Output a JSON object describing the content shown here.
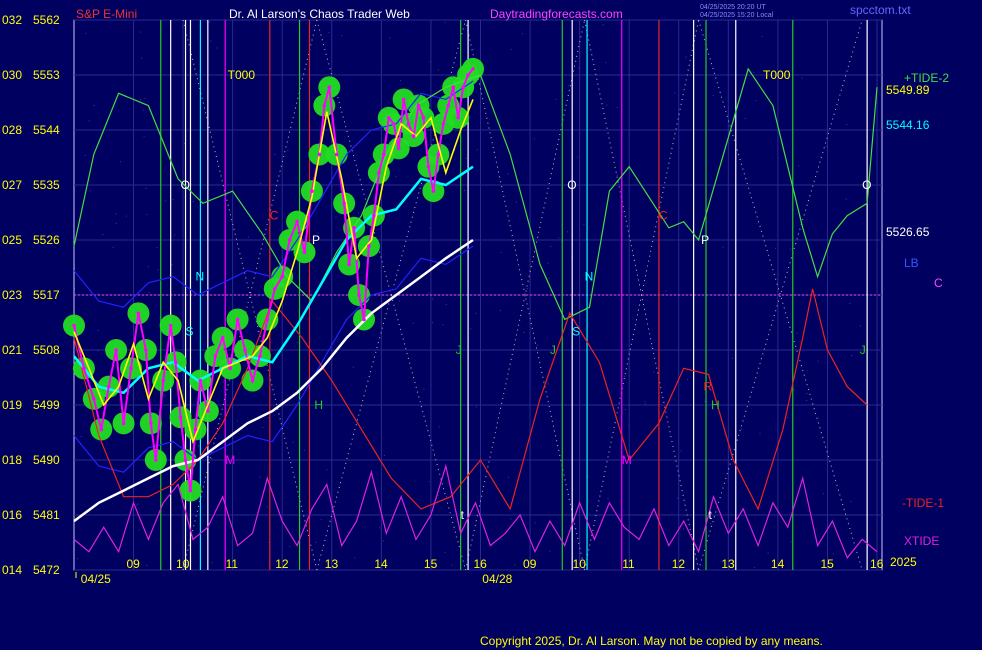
{
  "header": {
    "instrument": "S&P E-Mini",
    "author": "Dr. Al Larson's Chaos Trader Web",
    "site": "Daytradingforecasts.com",
    "stamp_utc": "04/25/2025 20:20 UT",
    "stamp_local": "04/25/2025 15:20 Local",
    "file": "spcctom.txt"
  },
  "footer": {
    "copyright": "Copyright 2025, Dr. Al Larson. May not be copied by any means."
  },
  "colors": {
    "background": "#000060",
    "frame": "#c8c8ff",
    "price": "#ff00ff",
    "fast_avg": "#ffff00",
    "slow_avg": "#00ffff",
    "long_avg": "#ffffff",
    "tide2": "#44dd44",
    "tide1": "#ee2222",
    "xtide": "#dd22dd",
    "bubble": "#22dd22"
  },
  "chart_data": {
    "type": "line",
    "title": "S&P E-Mini",
    "y_labels": [
      {
        "pre": "032",
        "price": 5562
      },
      {
        "pre": "030",
        "price": 5553
      },
      {
        "pre": "028",
        "price": 5544
      },
      {
        "pre": "027",
        "price": 5535
      },
      {
        "pre": "025",
        "price": 5526
      },
      {
        "pre": "023",
        "price": 5517
      },
      {
        "pre": "021",
        "price": 5508
      },
      {
        "pre": "019",
        "price": 5499
      },
      {
        "pre": "018",
        "price": 5490
      },
      {
        "pre": "016",
        "price": 5481
      },
      {
        "pre": "014",
        "price": 5472
      }
    ],
    "ylim": [
      5472,
      5562
    ],
    "x_hour_ticks": [
      {
        "hour": "09",
        "x": 1.2
      },
      {
        "hour": "10",
        "x": 2.2
      },
      {
        "hour": "11",
        "x": 3.2
      },
      {
        "hour": "12",
        "x": 4.2
      },
      {
        "hour": "13",
        "x": 5.2
      },
      {
        "hour": "14",
        "x": 6.2
      },
      {
        "hour": "15",
        "x": 7.2
      },
      {
        "hour": "16",
        "x": 8.2
      },
      {
        "hour": "09",
        "x": 9.2
      },
      {
        "hour": "10",
        "x": 10.2
      },
      {
        "hour": "11",
        "x": 11.2
      },
      {
        "hour": "12",
        "x": 12.2
      },
      {
        "hour": "13",
        "x": 13.2
      },
      {
        "hour": "14",
        "x": 14.2
      },
      {
        "hour": "15",
        "x": 15.2
      },
      {
        "hour": "16",
        "x": 16.2
      }
    ],
    "xlim": [
      0,
      16.3
    ],
    "dates": [
      {
        "label": "04/25",
        "x": 0.5
      },
      {
        "label": "04/28",
        "x": 8.6
      }
    ],
    "year": "2025",
    "price_series": {
      "name": "S&P E-Mini",
      "x": [
        0,
        0.2,
        0.4,
        0.55,
        0.7,
        0.85,
        1.0,
        1.15,
        1.3,
        1.45,
        1.55,
        1.65,
        1.8,
        1.95,
        2.05,
        2.15,
        2.25,
        2.35,
        2.45,
        2.55,
        2.7,
        2.85,
        3.0,
        3.15,
        3.3,
        3.45,
        3.6,
        3.75,
        3.9,
        4.05,
        4.2,
        4.35,
        4.5,
        4.65,
        4.8,
        4.95,
        5.05,
        5.15,
        5.3,
        5.45,
        5.55,
        5.65,
        5.75,
        5.85,
        5.95,
        6.05,
        6.15,
        6.25,
        6.35,
        6.45,
        6.55,
        6.65,
        6.75,
        6.85,
        6.95,
        7.05,
        7.15,
        7.25,
        7.35,
        7.45,
        7.55,
        7.65,
        7.75,
        7.85,
        7.95,
        8.05
      ],
      "y": [
        5512,
        5505,
        5500,
        5495,
        5502,
        5508,
        5496,
        5505,
        5514,
        5508,
        5496,
        5490,
        5503,
        5512,
        5506,
        5497,
        5490,
        5485,
        5495,
        5503,
        5498,
        5507,
        5510,
        5505,
        5513,
        5508,
        5503,
        5507,
        5513,
        5518,
        5520,
        5526,
        5529,
        5524,
        5534,
        5540,
        5548,
        5551,
        5540,
        5532,
        5522,
        5528,
        5517,
        5513,
        5525,
        5530,
        5537,
        5540,
        5546,
        5545,
        5541,
        5549,
        5545,
        5543,
        5548,
        5546,
        5538,
        5534,
        5540,
        5545,
        5548,
        5551,
        5546,
        5551,
        5553,
        5554
      ],
      "price_current": 5549.89
    },
    "fast_avg": {
      "x": [
        0,
        0.3,
        0.6,
        0.9,
        1.2,
        1.5,
        1.8,
        2.1,
        2.4,
        2.7,
        3.0,
        3.3,
        3.6,
        3.9,
        4.2,
        4.5,
        4.8,
        5.1,
        5.4,
        5.7,
        6.0,
        6.3,
        6.6,
        6.9,
        7.2,
        7.5,
        7.8,
        8.05
      ],
      "y": [
        5511,
        5505,
        5499,
        5502,
        5509,
        5500,
        5506,
        5503,
        5493,
        5499,
        5505,
        5506,
        5507,
        5510,
        5516,
        5524,
        5533,
        5547,
        5536,
        5523,
        5526,
        5538,
        5545,
        5543,
        5546,
        5537,
        5544,
        5549
      ]
    },
    "slow_avg": {
      "x": [
        0,
        0.5,
        1.0,
        1.5,
        2.0,
        2.5,
        3.0,
        3.5,
        4.0,
        4.5,
        5.0,
        5.5,
        6.0,
        6.5,
        7.0,
        7.5,
        8.05
      ],
      "y": [
        5507,
        5502,
        5501,
        5505,
        5506,
        5503,
        5505,
        5507,
        5506,
        5512,
        5519,
        5526,
        5530,
        5531,
        5536,
        5535,
        5538
      ],
      "value_current": 5544.16
    },
    "long_avg": {
      "x": [
        0,
        0.5,
        1.0,
        1.5,
        2.0,
        2.5,
        3.0,
        3.5,
        4.0,
        4.5,
        5.0,
        5.5,
        6.0,
        6.5,
        7.0,
        7.5,
        8.05
      ],
      "y": [
        5480,
        5483,
        5485,
        5487,
        5489,
        5490,
        5493,
        5496,
        5498,
        5501,
        5505,
        5510,
        5514,
        5517,
        5520,
        5523,
        5526
      ],
      "value_current": 5526.65
    },
    "tide_plus2": {
      "name": "+TIDE-2",
      "x": [
        0,
        0.4,
        0.9,
        1.5,
        2.1,
        2.6,
        3.2,
        3.8,
        4.3,
        4.8,
        5.3,
        5.8,
        6.3,
        6.9,
        7.5,
        8.2,
        8.8,
        9.4,
        9.9,
        10.4,
        10.8,
        11.2,
        11.6,
        12.0,
        12.3,
        12.6,
        13.1,
        13.6,
        14.1,
        14.7,
        15.0,
        15.3,
        15.6,
        16.0,
        16.2
      ],
      "y": [
        5525,
        5540,
        5550,
        5548,
        5536,
        5532,
        5534,
        5527,
        5520,
        5516,
        5524,
        5530,
        5540,
        5548,
        5551,
        5553,
        5540,
        5522,
        5513,
        5515,
        5534,
        5538,
        5533,
        5528,
        5529,
        5526,
        5540,
        5554,
        5548,
        5528,
        5520,
        5527,
        5530,
        5532,
        5551
      ]
    },
    "tide_minus1": {
      "name": "-TIDE-1",
      "x": [
        0,
        0.5,
        1.0,
        1.5,
        2.0,
        2.5,
        3.0,
        3.5,
        4.0,
        4.6,
        5.2,
        5.8,
        6.4,
        7.0,
        7.6,
        8.2,
        8.8,
        9.4,
        10.0,
        10.6,
        11.2,
        11.8,
        12.3,
        12.8,
        13.3,
        13.8,
        14.3,
        14.7,
        14.9,
        15.2,
        15.6,
        16.0
      ],
      "y": [
        5510,
        5494,
        5484,
        5484,
        5486,
        5490,
        5496,
        5505,
        5516,
        5510,
        5503,
        5495,
        5487,
        5482,
        5484,
        5490,
        5482,
        5500,
        5514,
        5506,
        5490,
        5496,
        5505,
        5504,
        5490,
        5482,
        5495,
        5510,
        5518,
        5508,
        5502,
        5499
      ]
    },
    "xtide": {
      "name": "XTIDE",
      "x": [
        0,
        0.3,
        0.6,
        0.9,
        1.2,
        1.5,
        1.8,
        2.1,
        2.4,
        2.7,
        3.0,
        3.3,
        3.6,
        3.9,
        4.2,
        4.5,
        4.8,
        5.1,
        5.4,
        5.7,
        6.0,
        6.3,
        6.6,
        6.9,
        7.2,
        7.5,
        7.8,
        8.1,
        8.4,
        8.7,
        9.0,
        9.3,
        9.6,
        9.9,
        10.2,
        10.5,
        10.8,
        11.1,
        11.4,
        11.7,
        12.0,
        12.3,
        12.6,
        12.9,
        13.2,
        13.5,
        13.8,
        14.1,
        14.4,
        14.7,
        15.0,
        15.3,
        15.6,
        15.9,
        16.2
      ],
      "y": [
        5477,
        5475,
        5479,
        5475,
        5483,
        5477,
        5483,
        5486,
        5477,
        5479,
        5484,
        5476,
        5478,
        5487,
        5480,
        5476,
        5482,
        5486,
        5476,
        5480,
        5488,
        5478,
        5484,
        5477,
        5481,
        5489,
        5478,
        5483,
        5476,
        5478,
        5481,
        5475,
        5480,
        5476,
        5483,
        5477,
        5483,
        5479,
        5477,
        5482,
        5476,
        5480,
        5475,
        5484,
        5478,
        5482,
        5476,
        5483,
        5479,
        5487,
        5476,
        5480,
        5474,
        5477,
        5475
      ]
    },
    "pivot_line": 5517,
    "verticals": [
      {
        "x": 1.75,
        "color": "#22cc22"
      },
      {
        "x": 1.95,
        "color": "#ffffff"
      },
      {
        "x": 2.25,
        "color": "#ffffff"
      },
      {
        "x": 2.35,
        "color": "#ffffff"
      },
      {
        "x": 2.55,
        "color": "#00ffff"
      },
      {
        "x": 2.7,
        "color": "#ffffff"
      },
      {
        "x": 3.05,
        "color": "#ff00ff"
      },
      {
        "x": 3.95,
        "color": "#ee2222"
      },
      {
        "x": 4.55,
        "color": "#22cc22"
      },
      {
        "x": 4.75,
        "color": "#ee2222"
      },
      {
        "x": 7.8,
        "color": "#22cc22"
      },
      {
        "x": 7.95,
        "color": "#ffffff"
      },
      {
        "x": 9.85,
        "color": "#22cc22"
      },
      {
        "x": 10.05,
        "color": "#ffffff"
      },
      {
        "x": 10.35,
        "color": "#00ffff"
      },
      {
        "x": 11.05,
        "color": "#ff00ff"
      },
      {
        "x": 11.8,
        "color": "#ee2222"
      },
      {
        "x": 12.5,
        "color": "#ffffff"
      },
      {
        "x": 12.75,
        "color": "#22cc22"
      },
      {
        "x": 13.35,
        "color": "#ffffff"
      },
      {
        "x": 14.5,
        "color": "#22cc22"
      },
      {
        "x": 16.0,
        "color": "#ffffff"
      }
    ],
    "markers": [
      {
        "text": "T000",
        "x": 3.1,
        "y": 5553,
        "color": "#ffff00"
      },
      {
        "text": "T000",
        "x": 13.9,
        "y": 5553,
        "color": "#ffff00"
      },
      {
        "text": "O",
        "x": 2.15,
        "y": 5535,
        "color": "#ffffff"
      },
      {
        "text": "O",
        "x": 9.95,
        "y": 5535,
        "color": "#ffffff"
      },
      {
        "text": "O",
        "x": 15.9,
        "y": 5535,
        "color": "#ffffff"
      },
      {
        "text": "C",
        "x": 3.95,
        "y": 5530,
        "color": "#ee2222"
      },
      {
        "text": "C",
        "x": 11.8,
        "y": 5530,
        "color": "#ee2222"
      },
      {
        "text": "P",
        "x": 4.8,
        "y": 5526,
        "color": "#ffffff"
      },
      {
        "text": "P",
        "x": 12.65,
        "y": 5526,
        "color": "#ffffff"
      },
      {
        "text": "N",
        "x": 2.45,
        "y": 5520,
        "color": "#00ffff"
      },
      {
        "text": "N",
        "x": 10.3,
        "y": 5520,
        "color": "#00ffff"
      },
      {
        "text": "S",
        "x": 2.25,
        "y": 5511,
        "color": "#00ffff"
      },
      {
        "text": "S",
        "x": 10.05,
        "y": 5511,
        "color": "#00ffff"
      },
      {
        "text": "J",
        "x": 7.7,
        "y": 5508,
        "color": "#22cc22"
      },
      {
        "text": "J",
        "x": 9.6,
        "y": 5508,
        "color": "#22cc22"
      },
      {
        "text": "J",
        "x": 15.85,
        "y": 5508,
        "color": "#22cc22"
      },
      {
        "text": "R",
        "x": 12.7,
        "y": 5502,
        "color": "#ee2222"
      },
      {
        "text": "H",
        "x": 4.85,
        "y": 5499,
        "color": "#22cc22"
      },
      {
        "text": "H",
        "x": 12.85,
        "y": 5499,
        "color": "#22cc22"
      },
      {
        "text": "M",
        "x": 3.05,
        "y": 5490,
        "color": "#ff00ff"
      },
      {
        "text": "M",
        "x": 11.05,
        "y": 5490,
        "color": "#ff00ff"
      },
      {
        "text": "t",
        "x": 7.8,
        "y": 5481,
        "color": "#ffffff"
      },
      {
        "text": "t",
        "x": 12.8,
        "y": 5481,
        "color": "#ffffff"
      }
    ],
    "right_labels": {
      "tide2": "+TIDE-2",
      "price": "5549.89",
      "slow": "5544.16",
      "long": "5526.65",
      "lb": "LB",
      "c": "C",
      "tide1": "-TIDE-1",
      "xtide": "XTIDE",
      "year": "2025"
    }
  }
}
